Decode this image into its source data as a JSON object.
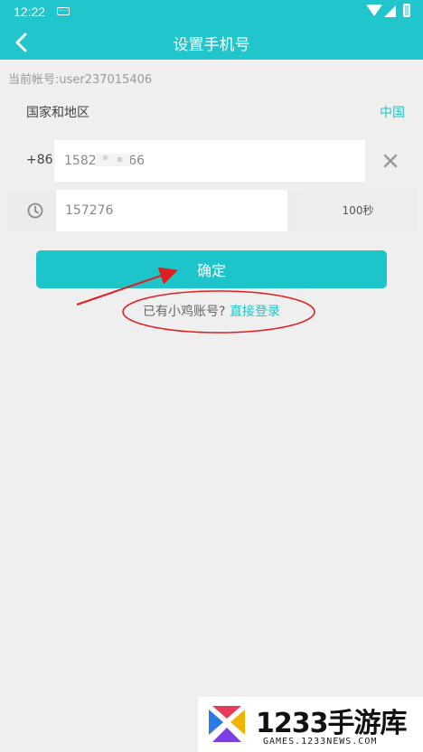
{
  "status_bar": {
    "time": "12:22"
  },
  "app_bar": {
    "title": "设置手机号"
  },
  "account": {
    "text": "当前帐号:user237015406"
  },
  "country": {
    "label": "国家和地区",
    "value": "中国"
  },
  "phone": {
    "prefix": "+86",
    "value": "1582      266"
  },
  "code": {
    "value": "157276",
    "countdown": "100秒"
  },
  "confirm": {
    "label": "确定"
  },
  "login": {
    "prompt": "已有小鸡账号? ",
    "link": "直接登录"
  },
  "colors": {
    "primary": "#20c6cc",
    "annotation": "#e02020",
    "background": "#efefef"
  },
  "icons": {
    "back": "back-arrow-icon",
    "clear": "close-icon",
    "clock": "clock-icon"
  },
  "watermark": {
    "brand": "1233手游库",
    "url": "GAMES.1233NEWS.COM"
  }
}
